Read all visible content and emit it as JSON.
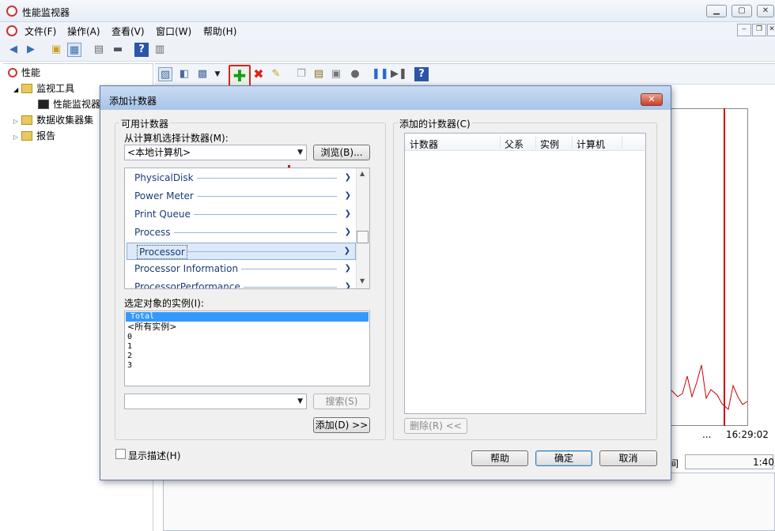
{
  "window": {
    "title": "性能监视器"
  },
  "menu": {
    "file": "文件(F)",
    "action": "操作(A)",
    "view": "查看(V)",
    "window": "窗口(W)",
    "help": "帮助(H)"
  },
  "tree": {
    "root": "性能",
    "monitoring_tools": "监视工具",
    "perf_monitor": "性能监视器",
    "data_collector_sets": "数据收集器集",
    "reports": "报告"
  },
  "graph": {
    "time_dots": "...",
    "time_end": "16:29:02",
    "duration_label": "间",
    "duration_value": "1:40"
  },
  "dialog": {
    "title": "添加计数器",
    "close": "✕",
    "available_counters": "可用计数器",
    "select_from": "从计算机选择计数器(M):",
    "computer": "<本地计算机>",
    "browse": "浏览(B)...",
    "counters": [
      "PhysicalDisk",
      "Power Meter",
      "Print Queue",
      "Process",
      "Processor",
      "Processor Information",
      "ProcessorPerformance"
    ],
    "selected_counter": "Processor",
    "instances_label": "选定对象的实例(I):",
    "instances": [
      "Total",
      "<所有实例>",
      "0",
      "1",
      "2",
      "3"
    ],
    "selected_instance": "Total",
    "search_value": "",
    "search": "搜索(S)",
    "add": "添加(D) >>",
    "added_counters": "添加的计数器(C)",
    "columns": [
      "计数器",
      "父系",
      "实例",
      "计算机"
    ],
    "remove": "删除(R) <<",
    "show_description": "显示描述(H)",
    "help": "帮助",
    "ok": "确定",
    "cancel": "取消"
  },
  "colors": {
    "accent": "#3399ff",
    "highlight": "#dd2222",
    "graph_line": "#cc0000"
  }
}
